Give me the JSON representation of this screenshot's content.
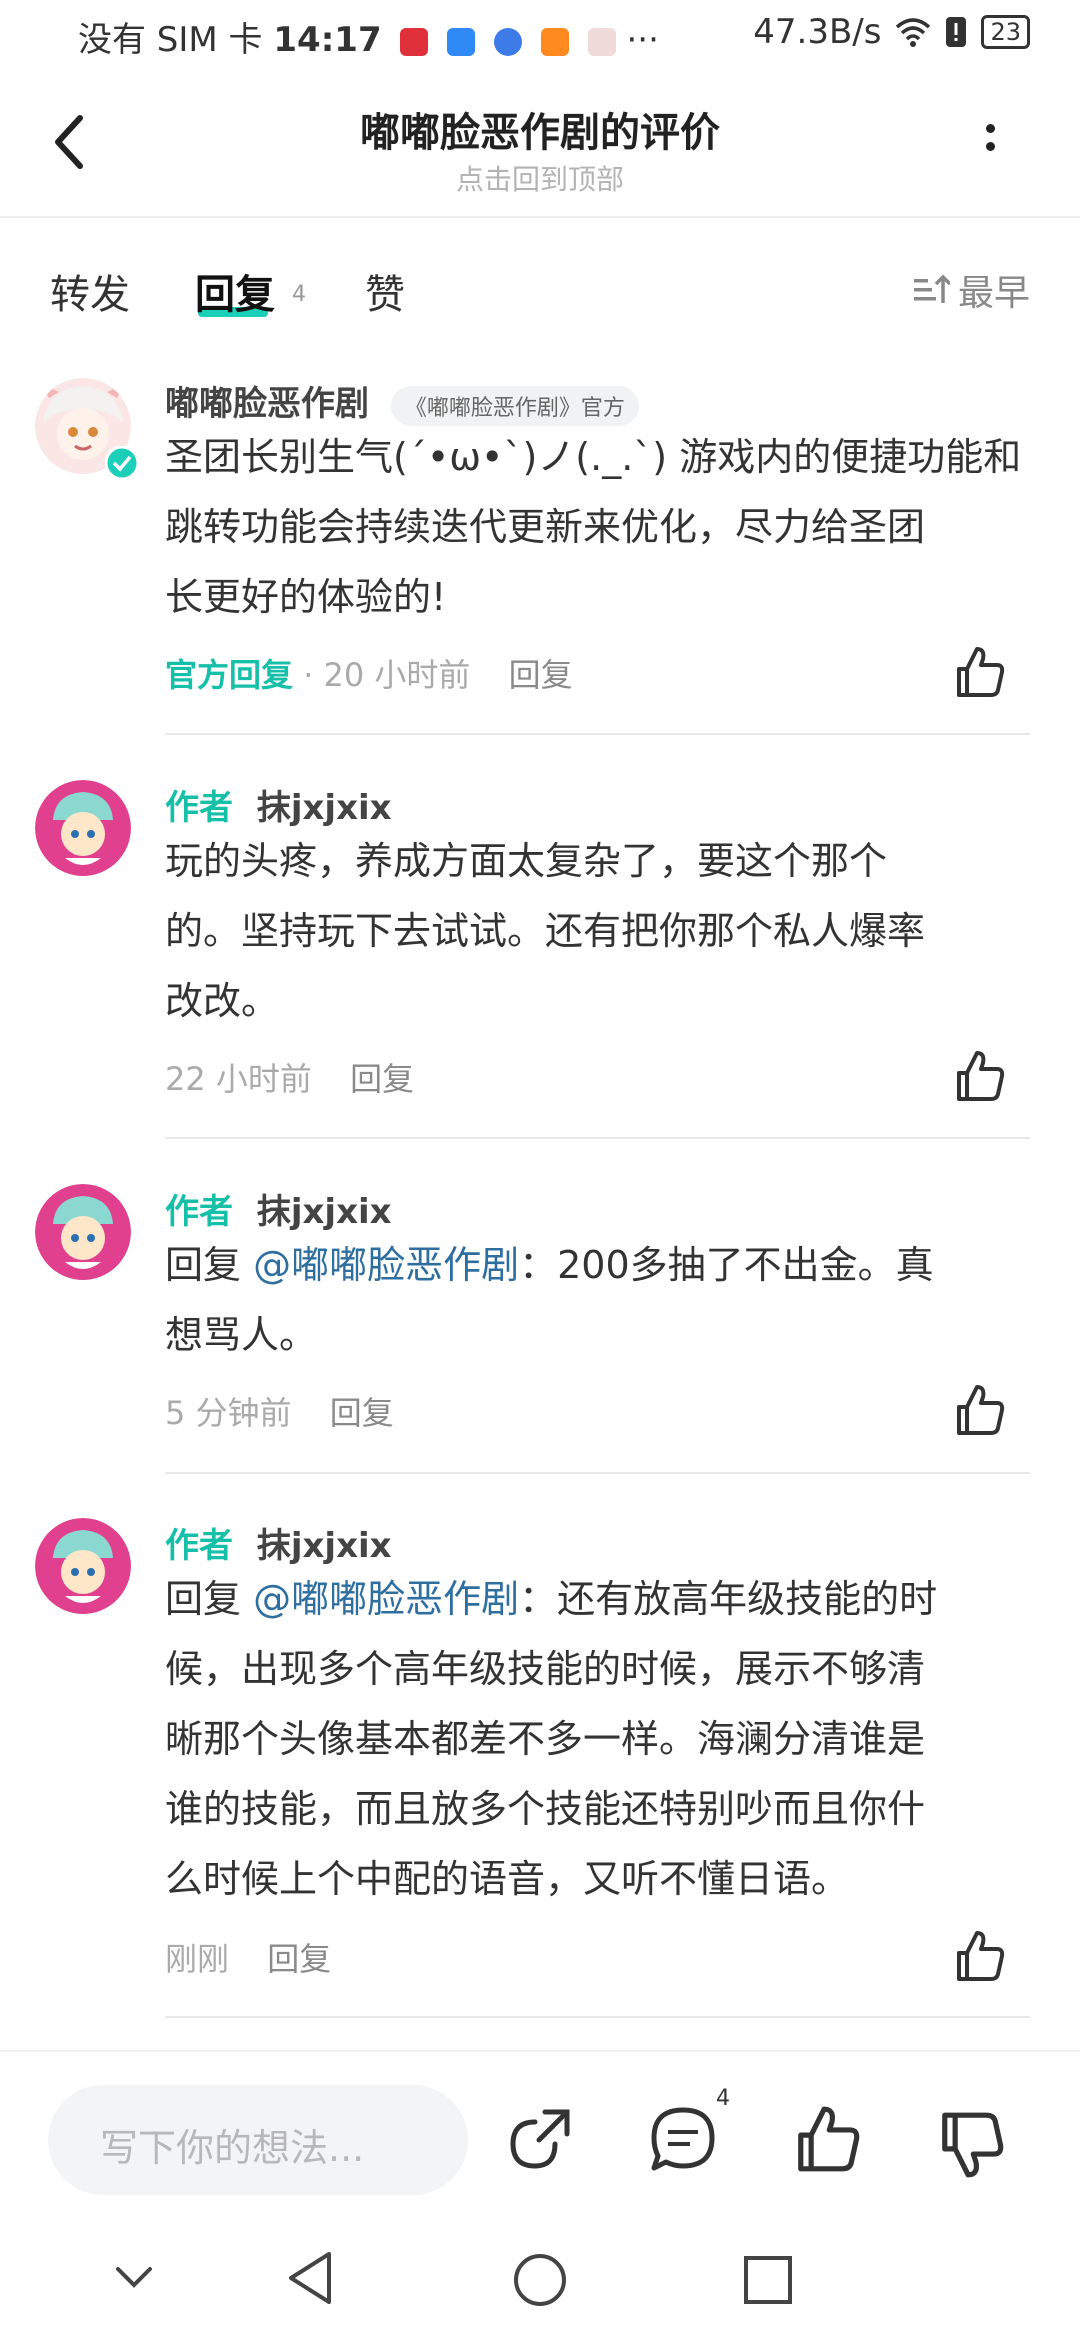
{
  "status_bar": {
    "carrier": "没有 SIM 卡",
    "time": "14:17",
    "more": "···",
    "speed": "47.3B/s",
    "battery": "23"
  },
  "header": {
    "title": "嘟嘟脸恶作剧的评价",
    "subtitle": "点击回到顶部"
  },
  "tabs": {
    "forward": "转发",
    "reply": "回复",
    "reply_count": "4",
    "like": "赞",
    "sort": "最早"
  },
  "comments": [
    {
      "author": "嘟嘟脸恶作剧",
      "badge": "《嘟嘟脸恶作剧》官方",
      "lines": [
        "圣团长别生气(ˊ•ω•ˋ)ノ(._.`) 游戏内的便捷功能和",
        "跳转功能会持续迭代更新来优化，尽力给圣团",
        "长更好的体验的!"
      ],
      "official_reply": "官方回复",
      "time": "· 20 小时前",
      "reply_label": "回复"
    },
    {
      "author_tag": "作者",
      "author": "抹jxjxix",
      "lines": [
        "玩的头疼，养成方面太复杂了，要这个那个",
        "的。坚持玩下去试试。还有把你那个私人爆率",
        "改改。"
      ],
      "time": "22 小时前",
      "reply_label": "回复"
    },
    {
      "author_tag": "作者",
      "author": "抹jxjxix",
      "reply_prefix": "回复",
      "mention": "@嘟嘟脸恶作剧",
      "first_line_rest": "：200多抽了不出金。真",
      "lines": [
        "想骂人。"
      ],
      "time": "5 分钟前",
      "reply_label": "回复"
    },
    {
      "author_tag": "作者",
      "author": "抹jxjxix",
      "reply_prefix": "回复",
      "mention": "@嘟嘟脸恶作剧",
      "first_line_rest": "：还有放高年级技能的时",
      "lines": [
        "候，出现多个高年级技能的时候，展示不够清",
        "晰那个头像基本都差不多一样。海澜分清谁是",
        "谁的技能，而且放多个技能还特别吵而且你什",
        "么时候上个中配的语音，又听不懂日语。"
      ],
      "time": "刚刚",
      "reply_label": "回复"
    }
  ],
  "bottom": {
    "placeholder": "写下你的想法...",
    "reply_count": "4"
  },
  "colors": {
    "accent": "#16bfa8",
    "mention": "#2e6fa0",
    "meta": "#aaaaaa"
  },
  "icons": [
    "back-arrow-icon",
    "more-vert-icon",
    "sort-icon",
    "like-icon",
    "share-icon",
    "comment-icon",
    "dislike-icon",
    "nav-back-icon",
    "nav-home-icon",
    "nav-recents-icon",
    "nav-down-icon",
    "wifi-icon"
  ]
}
